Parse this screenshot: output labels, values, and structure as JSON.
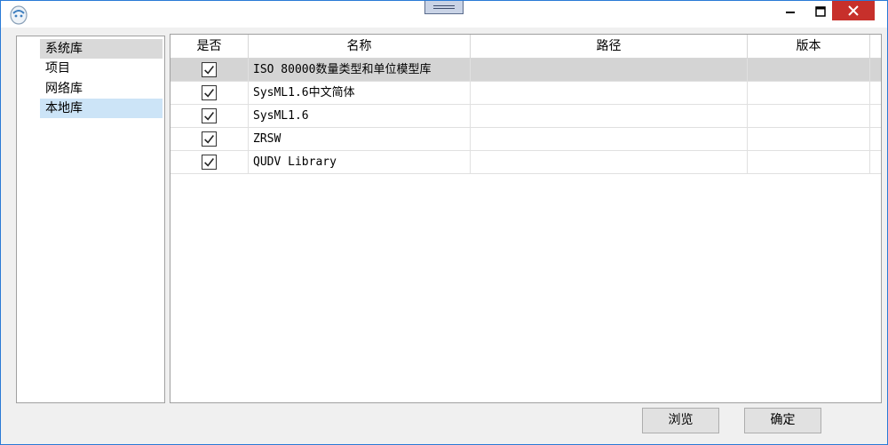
{
  "grid": {
    "headers": [
      "是否",
      "名称",
      "路径",
      "版本"
    ],
    "rows": [
      {
        "checked": true,
        "name": "ISO 80000数量类型和单位模型库",
        "path": "",
        "version": ""
      },
      {
        "checked": true,
        "name": "SysML1.6中文简体",
        "path": "",
        "version": ""
      },
      {
        "checked": true,
        "name": "SysML1.6",
        "path": "",
        "version": ""
      },
      {
        "checked": true,
        "name": "ZRSW",
        "path": "",
        "version": ""
      },
      {
        "checked": true,
        "name": "QUDV Library",
        "path": "",
        "version": ""
      }
    ]
  },
  "tree": {
    "items": [
      "系统库",
      "项目",
      "网络库",
      "本地库"
    ]
  },
  "buttons": {
    "browse": "浏览",
    "ok": "确定"
  },
  "colors": {
    "accent": "#2a7ad6",
    "close": "#c7302b",
    "selected_row": "#d4d4d4",
    "tree_highlight": "#cce4f7"
  }
}
